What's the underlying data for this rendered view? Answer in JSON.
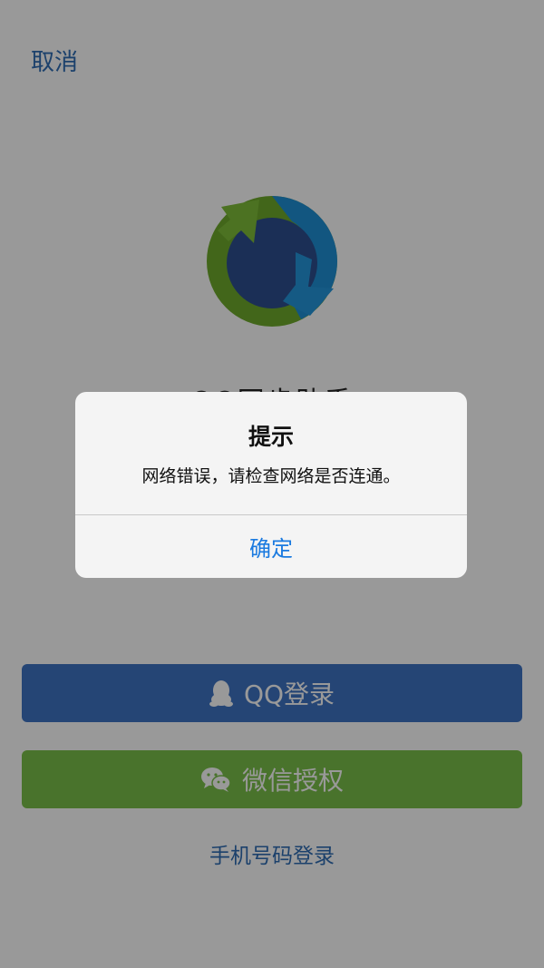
{
  "header": {
    "cancel_label": "取消"
  },
  "app": {
    "name": "QQ同步助手"
  },
  "login": {
    "qq_label": "QQ登录",
    "wechat_label": "微信授权",
    "phone_label": "手机号码登录"
  },
  "dialog": {
    "title": "提示",
    "message": "网络错误，请检查网络是否连通。",
    "confirm_label": "确定"
  },
  "icons": {
    "qq": "qq-penguin-icon",
    "wechat": "wechat-icon",
    "logo": "sync-logo-icon"
  },
  "colors": {
    "accent": "#2f6db4",
    "qq_button": "#3e74c4",
    "wechat_button": "#7bc04a",
    "dialog_button": "#1a7ae0"
  }
}
